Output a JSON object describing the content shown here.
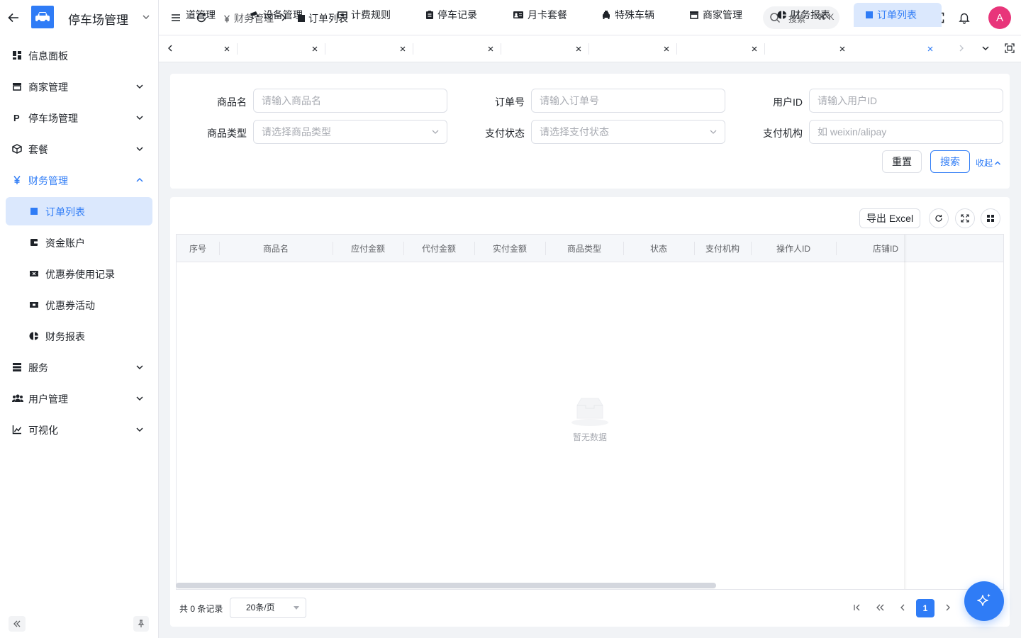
{
  "app": {
    "title": "停车场管理",
    "colors": {
      "primary": "#2f7cf6",
      "active_bg": "#dbe8fd",
      "avatar": "#e8357a"
    }
  },
  "sidebar": {
    "items": [
      {
        "label": "信息面板",
        "icon": "dashboard-icon",
        "expandable": false
      },
      {
        "label": "商家管理",
        "icon": "store-icon",
        "expandable": true
      },
      {
        "label": "停车场管理",
        "icon": "parking-icon",
        "expandable": true
      },
      {
        "label": "套餐",
        "icon": "package-icon",
        "expandable": true
      },
      {
        "label": "财务管理",
        "icon": "yuan-icon",
        "expandable": true,
        "open": true
      },
      {
        "label": "服务",
        "icon": "server-icon",
        "expandable": true
      },
      {
        "label": "用户管理",
        "icon": "users-icon",
        "expandable": true
      },
      {
        "label": "可视化",
        "icon": "chart-icon",
        "expandable": true
      }
    ],
    "finance_children": [
      {
        "label": "订单列表",
        "icon": "square-icon",
        "active": true
      },
      {
        "label": "资金账户",
        "icon": "wallet-icon"
      },
      {
        "label": "优惠券使用记录",
        "icon": "ticket-icon"
      },
      {
        "label": "优惠券活动",
        "icon": "coupon-icon"
      },
      {
        "label": "财务报表",
        "icon": "pie-icon"
      }
    ]
  },
  "header": {
    "breadcrumb": [
      {
        "label": "财务管理",
        "icon": "yuan-icon"
      },
      {
        "label": "订单列表",
        "icon": "square-icon"
      }
    ],
    "search_label": "搜索",
    "search_shortcut": "⌘ K",
    "avatar": "A"
  },
  "tabs": [
    {
      "label": "道管理",
      "icon": ""
    },
    {
      "label": "设备管理",
      "icon": "camera-icon"
    },
    {
      "label": "计费规则",
      "icon": "money-icon"
    },
    {
      "label": "停车记录",
      "icon": "clipboard-icon"
    },
    {
      "label": "月卡套餐",
      "icon": "card-icon"
    },
    {
      "label": "特殊车辆",
      "icon": "taxi-icon"
    },
    {
      "label": "商家管理",
      "icon": "store-icon"
    },
    {
      "label": "财务报表",
      "icon": "pie-icon"
    },
    {
      "label": "订单列表",
      "icon": "square-icon",
      "active": true
    }
  ],
  "filters": {
    "product_name": {
      "label": "商品名",
      "placeholder": "请输入商品名"
    },
    "order_no": {
      "label": "订单号",
      "placeholder": "请输入订单号"
    },
    "user_id": {
      "label": "用户ID",
      "placeholder": "请输入用户ID"
    },
    "product_type": {
      "label": "商品类型",
      "placeholder": "请选择商品类型"
    },
    "pay_status": {
      "label": "支付状态",
      "placeholder": "请选择支付状态"
    },
    "pay_org": {
      "label": "支付机构",
      "placeholder": "如 weixin/alipay"
    },
    "reset_label": "重置",
    "search_label": "搜索",
    "collapse_label": "收起"
  },
  "table": {
    "export_label": "导出 Excel",
    "columns": [
      "序号",
      "商品名",
      "应付金额",
      "代付金额",
      "实付金额",
      "商品类型",
      "状态",
      "支付机构",
      "操作人ID",
      "店铺ID"
    ],
    "rows": [],
    "empty_text": "暂无数据"
  },
  "pagination": {
    "total_text": "共 0 条记录",
    "page_size": "20条/页",
    "current_page": "1"
  }
}
